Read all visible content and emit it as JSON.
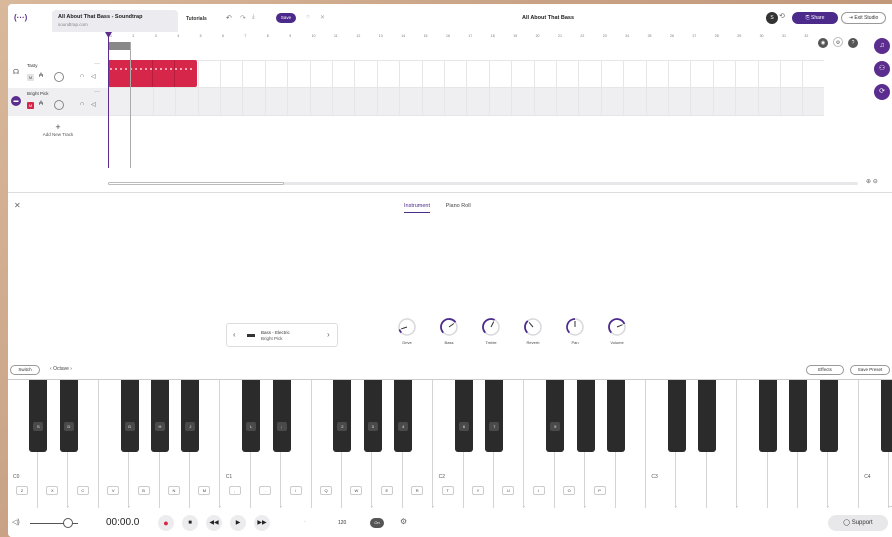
{
  "app": {
    "logo": "(···)",
    "browser_tab": {
      "title": "All About That Bass - Soundtrap",
      "url": "soundtrap.com"
    },
    "tutorials": "Tutorials",
    "save": "Save",
    "project_title": "All About That Bass",
    "share": "Share",
    "exit_studio": "Exit Studio",
    "profile_initial": "S"
  },
  "ruler": [
    "1",
    "2",
    "3",
    "4",
    "5",
    "6",
    "7",
    "8",
    "9",
    "10",
    "11",
    "12",
    "13",
    "14",
    "15",
    "16",
    "17",
    "18",
    "19",
    "20",
    "21",
    "22",
    "23",
    "24",
    "25",
    "26",
    "27",
    "28",
    "29",
    "30",
    "31",
    "32"
  ],
  "tracks": [
    {
      "name": "Tasty",
      "mute": "M"
    },
    {
      "name": "Bright Pick",
      "mute": "M"
    }
  ],
  "add_track": "Add New Track",
  "panel": {
    "tabs": [
      "Instrument",
      "Piano Roll"
    ],
    "instrument_line1": "Bass - Electric",
    "instrument_line2": "Bright Pick",
    "knobs": [
      {
        "label": "Drive",
        "value": 0.1
      },
      {
        "label": "Bass",
        "value": 0.7
      },
      {
        "label": "Treble",
        "value": 0.6
      },
      {
        "label": "Reverb",
        "value": 0.35
      },
      {
        "label": "Pan",
        "value": 0.5
      },
      {
        "label": "Volume",
        "value": 0.75
      }
    ],
    "switch": "Switch",
    "octave": "Octave",
    "effects": "Effects",
    "save_preset": "Save Preset"
  },
  "keyboard": {
    "white_labels": [
      "Z",
      "X",
      "C",
      "V",
      "B",
      "N",
      "M",
      ",",
      ".",
      "/",
      "Q",
      "W",
      "E",
      "R",
      "T",
      "Y",
      "U",
      "I",
      "O",
      "P"
    ],
    "black_labels": [
      "S",
      "D",
      "G",
      "H",
      "J",
      "L",
      ";",
      "2",
      "3",
      "4",
      "6",
      "7",
      "9"
    ],
    "octaves": [
      "C0",
      "C1",
      "C2",
      "C3",
      "C4"
    ]
  },
  "transport": {
    "time": "00:00.0",
    "tempo": "120",
    "metronome": "On",
    "support": "Support"
  },
  "colors": {
    "accent": "#4b2a8c",
    "clip": "#d6264a"
  }
}
